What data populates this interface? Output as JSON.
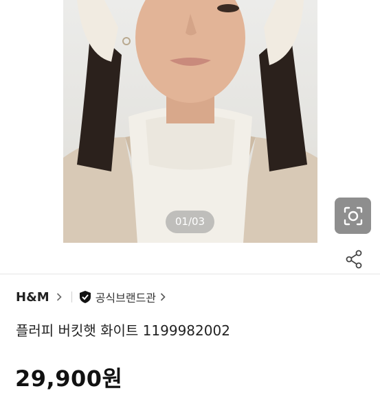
{
  "gallery": {
    "counter": "01/03",
    "image_alt": "Model wearing cream fluffy bucket hat, white turtleneck and beige coat"
  },
  "icons": {
    "lens": "camera-search-icon",
    "share": "share-icon",
    "badge": "shield-check-icon",
    "chevron": "chevron-right-icon"
  },
  "product": {
    "brand": "H&M",
    "official_label": "공식브랜드관",
    "title": "플러피 버킷햇 화이트 1199982002",
    "price": "29,900원"
  },
  "colors": {
    "counter_bg": "#969696",
    "lens_bg": "#8e8e8e",
    "divider": "#e6e6e6"
  }
}
